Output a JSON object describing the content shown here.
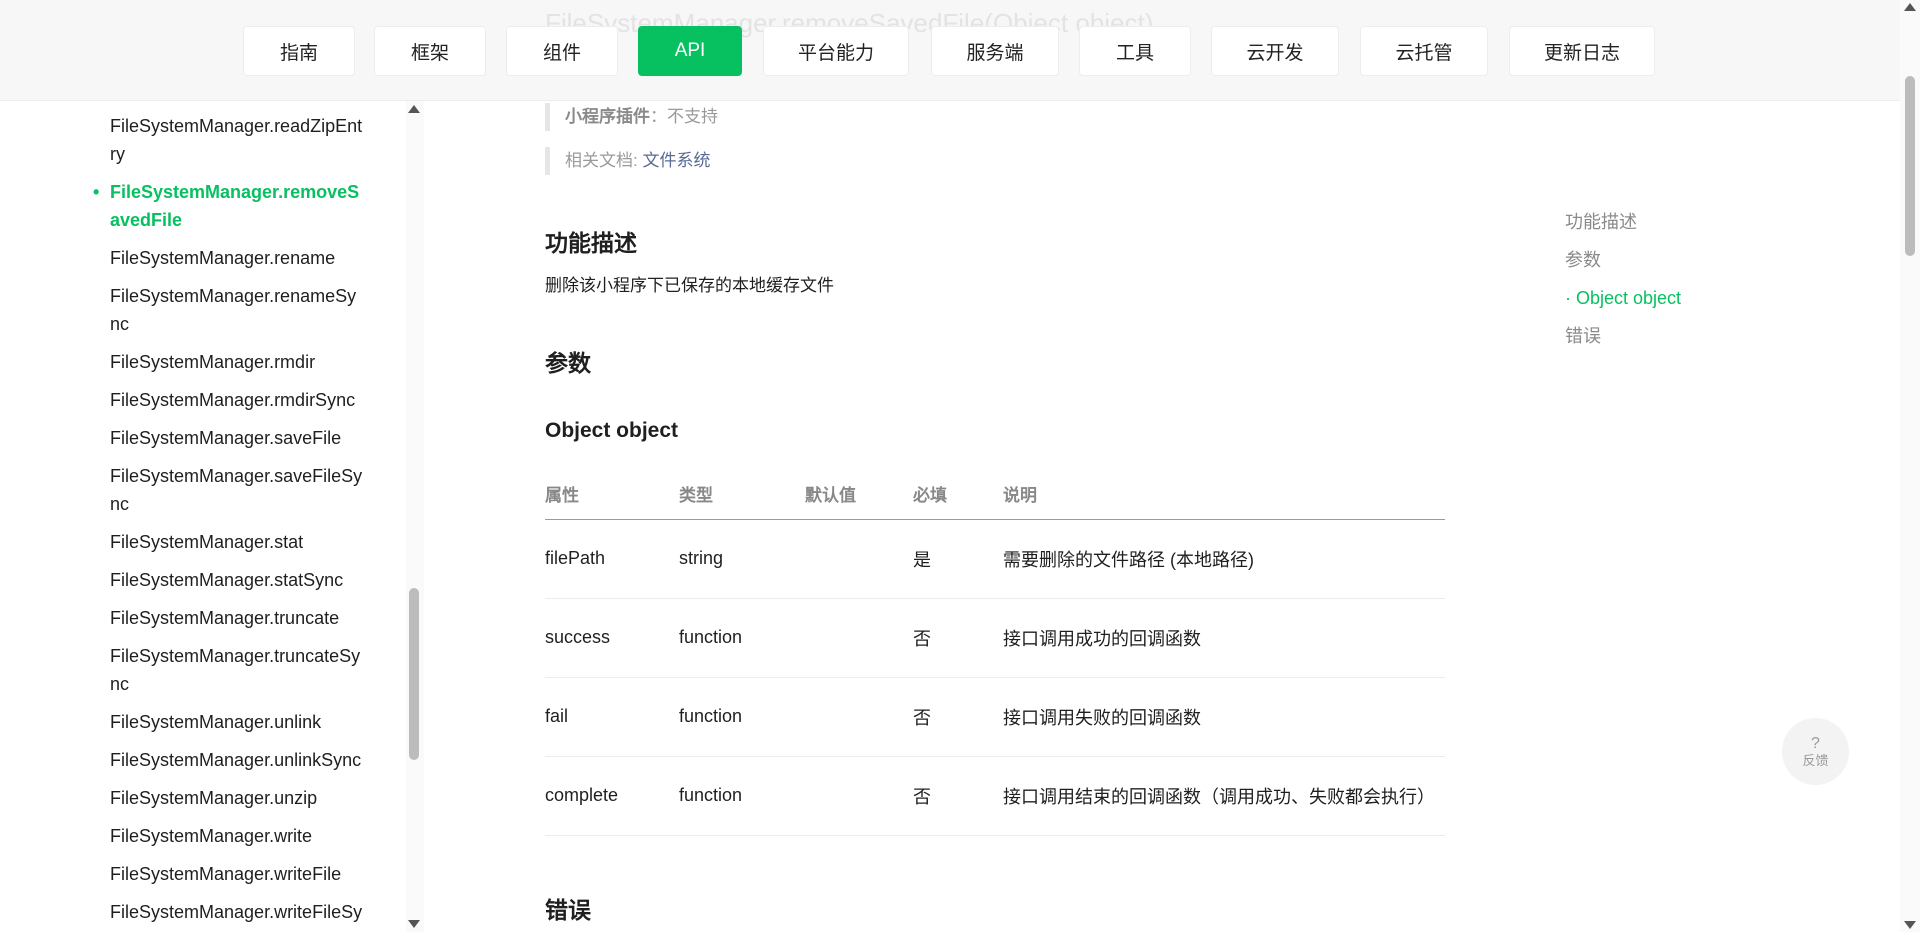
{
  "ghost_title": "FileSystemManager.removeSavedFile(Object object)",
  "nav": {
    "items": [
      {
        "label": "指南",
        "active": false
      },
      {
        "label": "框架",
        "active": false
      },
      {
        "label": "组件",
        "active": false
      },
      {
        "label": "API",
        "active": true
      },
      {
        "label": "平台能力",
        "active": false
      },
      {
        "label": "服务端",
        "active": false
      },
      {
        "label": "工具",
        "active": false
      },
      {
        "label": "云开发",
        "active": false
      },
      {
        "label": "云托管",
        "active": false
      },
      {
        "label": "更新日志",
        "active": false
      }
    ]
  },
  "sidebar": {
    "bullet": "•",
    "items": [
      {
        "label": "FileSystemManager.readZipEntry",
        "active": false
      },
      {
        "label": "FileSystemManager.removeSavedFile",
        "active": true
      },
      {
        "label": "FileSystemManager.rename",
        "active": false
      },
      {
        "label": "FileSystemManager.renameSync",
        "active": false
      },
      {
        "label": "FileSystemManager.rmdir",
        "active": false
      },
      {
        "label": "FileSystemManager.rmdirSync",
        "active": false
      },
      {
        "label": "FileSystemManager.saveFile",
        "active": false
      },
      {
        "label": "FileSystemManager.saveFileSync",
        "active": false
      },
      {
        "label": "FileSystemManager.stat",
        "active": false
      },
      {
        "label": "FileSystemManager.statSync",
        "active": false
      },
      {
        "label": "FileSystemManager.truncate",
        "active": false
      },
      {
        "label": "FileSystemManager.truncateSync",
        "active": false
      },
      {
        "label": "FileSystemManager.unlink",
        "active": false
      },
      {
        "label": "FileSystemManager.unlinkSync",
        "active": false
      },
      {
        "label": "FileSystemManager.unzip",
        "active": false
      },
      {
        "label": "FileSystemManager.write",
        "active": false
      },
      {
        "label": "FileSystemManager.writeFile",
        "active": false
      },
      {
        "label": "FileSystemManager.writeFileSync",
        "active": false
      }
    ]
  },
  "main": {
    "plugin_note": {
      "label": "小程序插件",
      "sep": "：",
      "value": "不支持"
    },
    "related_note": {
      "label": "相关文档: ",
      "link": "文件系统"
    },
    "section_desc_title": "功能描述",
    "desc_text": "删除该小程序下已保存的本地缓存文件",
    "section_params_title": "参数",
    "object_title": "Object object",
    "table": {
      "headers": [
        "属性",
        "类型",
        "默认值",
        "必填",
        "说明"
      ],
      "rows": [
        [
          "filePath",
          "string",
          "",
          "是",
          "需要删除的文件路径 (本地路径)"
        ],
        [
          "success",
          "function",
          "",
          "否",
          "接口调用成功的回调函数"
        ],
        [
          "fail",
          "function",
          "",
          "否",
          "接口调用失败的回调函数"
        ],
        [
          "complete",
          "function",
          "",
          "否",
          "接口调用结束的回调函数（调用成功、失败都会执行）"
        ]
      ]
    },
    "section_errors_title": "错误"
  },
  "toc": {
    "items": [
      {
        "label": "功能描述",
        "active": false
      },
      {
        "label": "参数",
        "active": false
      },
      {
        "label": "· Object object",
        "active": true
      },
      {
        "label": "错误",
        "active": false
      }
    ]
  },
  "feedback": {
    "icon": "?",
    "label": "反馈"
  },
  "colors": {
    "accent": "#07c160",
    "link": "#576b95"
  }
}
